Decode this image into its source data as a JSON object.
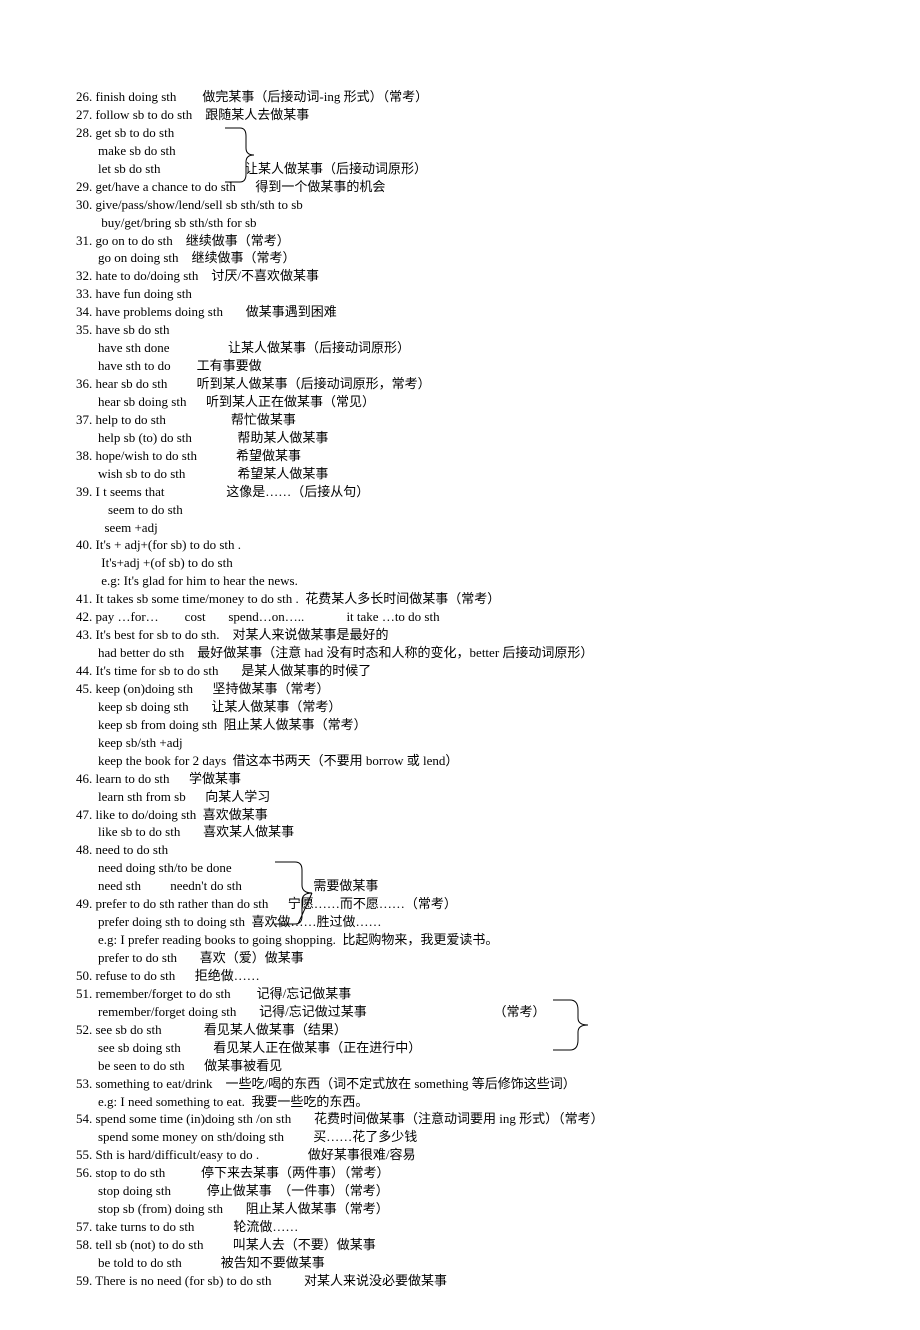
{
  "lines": [
    {
      "cls": "",
      "t": "26. finish doing sth        做完某事（后接动词-ing 形式）（常考）"
    },
    {
      "cls": "",
      "t": "27. follow sb to do sth    跟随某人去做某事"
    },
    {
      "cls": "",
      "t": "28. get sb to do sth"
    },
    {
      "cls": "indent1",
      "t": "make sb do sth"
    },
    {
      "cls": "indent1",
      "t": "let sb do sth                          让某人做某事（后接动词原形）"
    },
    {
      "cls": "",
      "t": "29. get/have a chance to do sth      得到一个做某事的机会"
    },
    {
      "cls": "",
      "t": "30. give/pass/show/lend/sell sb sth/sth to sb"
    },
    {
      "cls": "indent1",
      "t": " buy/get/bring sb sth/sth for sb"
    },
    {
      "cls": "",
      "t": "31. go on to do sth    继续做事（常考）"
    },
    {
      "cls": "indent1",
      "t": "go on doing sth    继续做事（常考）"
    },
    {
      "cls": "",
      "t": "32. hate to do/doing sth    讨厌/不喜欢做某事"
    },
    {
      "cls": "",
      "t": "33. have fun doing sth"
    },
    {
      "cls": "",
      "t": "34. have problems doing sth       做某事遇到困难"
    },
    {
      "cls": "",
      "t": "35. have sb do sth"
    },
    {
      "cls": "indent1",
      "t": "have sth done                  让某人做某事（后接动词原形）"
    },
    {
      "cls": "indent1",
      "t": "have sth to do        工有事要做"
    },
    {
      "cls": "",
      "t": "36. hear sb do sth         听到某人做某事（后接动词原形，常考）"
    },
    {
      "cls": "indent1",
      "t": "hear sb doing sth      听到某人正在做某事（常见）"
    },
    {
      "cls": "",
      "t": "37. help to do sth                    帮忙做某事"
    },
    {
      "cls": "indent1",
      "t": "help sb (to) do sth              帮助某人做某事"
    },
    {
      "cls": "",
      "t": "38. hope/wish to do sth            希望做某事"
    },
    {
      "cls": "indent1",
      "t": "wish sb to do sth                希望某人做某事"
    },
    {
      "cls": "",
      "t": "39. I t seems that                   这像是……（后接从句）"
    },
    {
      "cls": "indent2",
      "t": "seem to do sth"
    },
    {
      "cls": "indent1",
      "t": "  seem +adj"
    },
    {
      "cls": "",
      "t": "40. It's + adj+(for sb) to do sth ."
    },
    {
      "cls": "indent1",
      "t": " It's+adj +(of sb) to do sth"
    },
    {
      "cls": "indent1",
      "t": " e.g: It's glad for him to hear the news."
    },
    {
      "cls": "",
      "t": "41. It takes sb some time/money to do sth .  花费某人多长时间做某事（常考）"
    },
    {
      "cls": "",
      "t": "42. pay …for…        cost       spend…on…..             it take …to do sth"
    },
    {
      "cls": "",
      "t": "43. It's best for sb to do sth.    对某人来说做某事是最好的"
    },
    {
      "cls": "indent1",
      "t": "had better do sth    最好做某事（注意 had 没有时态和人称的变化，better 后接动词原形）"
    },
    {
      "cls": "",
      "t": "44. It's time for sb to do sth       是某人做某事的时候了"
    },
    {
      "cls": "",
      "t": "45. keep (on)doing sth      坚持做某事（常考）"
    },
    {
      "cls": "indent1",
      "t": "keep sb doing sth       让某人做某事（常考）"
    },
    {
      "cls": "indent1",
      "t": "keep sb from doing sth  阻止某人做某事（常考）"
    },
    {
      "cls": "indent1",
      "t": "keep sb/sth +adj"
    },
    {
      "cls": "indent1",
      "t": "keep the book for 2 days  借这本书两天（不要用 borrow 或 lend）"
    },
    {
      "cls": "",
      "t": "46. learn to do sth      学做某事"
    },
    {
      "cls": "indent1",
      "t": "learn sth from sb      向某人学习"
    },
    {
      "cls": "",
      "t": "47. like to do/doing sth  喜欢做某事"
    },
    {
      "cls": "indent1",
      "t": "like sb to do sth       喜欢某人做某事"
    },
    {
      "cls": "",
      "t": "48. need to do sth"
    },
    {
      "cls": "indent1",
      "t": "need doing sth/to be done"
    },
    {
      "cls": "indent1",
      "t": "need sth         needn't do sth                      需要做某事"
    },
    {
      "cls": "",
      "t": "49. prefer to do sth rather than do sth      宁愿……而不愿……（常考）"
    },
    {
      "cls": "indent1",
      "t": "prefer doing sth to doing sth  喜欢做……胜过做……"
    },
    {
      "cls": "indent1",
      "t": "e.g: I prefer reading books to going shopping.  比起购物来，我更爱读书。"
    },
    {
      "cls": "indent1",
      "t": "prefer to do sth       喜欢（爱）做某事"
    },
    {
      "cls": "",
      "t": "50. refuse to do sth      拒绝做……"
    },
    {
      "cls": "",
      "t": "51. remember/forget to do sth        记得/忘记做某事"
    },
    {
      "cls": "indent1",
      "t": "remember/forget doing sth       记得/忘记做过某事                                       （常考）"
    },
    {
      "cls": "",
      "t": "52. see sb do sth             看见某人做某事（结果）"
    },
    {
      "cls": "indent1",
      "t": "see sb doing sth          看见某人正在做某事（正在进行中）"
    },
    {
      "cls": "indent1",
      "t": "be seen to do sth      做某事被看见"
    },
    {
      "cls": "",
      "t": "53. something to eat/drink    一些吃/喝的东西（词不定式放在 something 等后修饰这些词）"
    },
    {
      "cls": "indent1",
      "t": "e.g: I need something to eat.  我要一些吃的东西。"
    },
    {
      "cls": "",
      "t": "54. spend some time (in)doing sth /on sth       花费时间做某事（注意动词要用 ing 形式）（常考）"
    },
    {
      "cls": "indent1",
      "t": "spend some money on sth/doing sth         买……花了多少钱"
    },
    {
      "cls": "",
      "t": "55. Sth is hard/difficult/easy to do .               做好某事很难/容易"
    },
    {
      "cls": "",
      "t": "56. stop to do sth           停下来去某事（两件事）（常考）"
    },
    {
      "cls": "indent1",
      "t": "stop doing sth           停止做某事  （一件事）（常考）"
    },
    {
      "cls": "indent1",
      "t": "stop sb (from) doing sth       阻止某人做某事（常考）"
    },
    {
      "cls": "",
      "t": "57. take turns to do sth            轮流做……"
    },
    {
      "cls": "",
      "t": "58. tell sb (not) to do sth         叫某人去（不要）做某事"
    },
    {
      "cls": "indent1",
      "t": "be told to do sth            被告知不要做某事"
    },
    {
      "cls": "",
      "t": "59. There is no need (for sb) to do sth          对某人来说没必要做某事"
    }
  ]
}
